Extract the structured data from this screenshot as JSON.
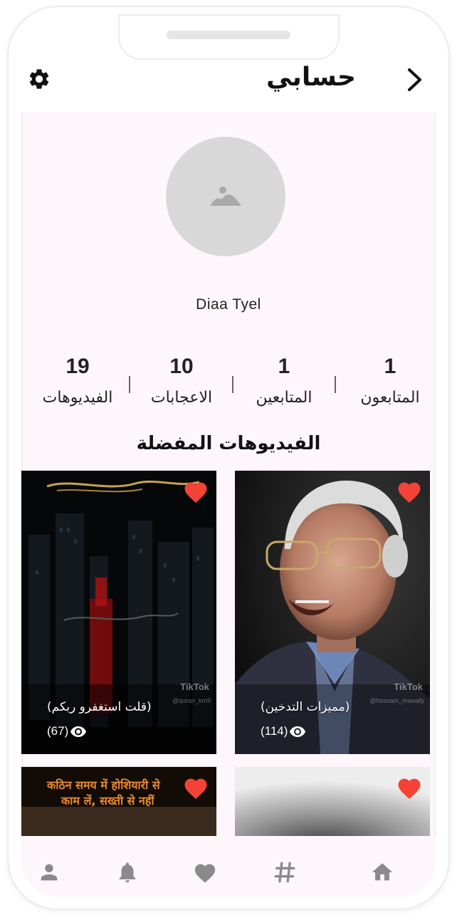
{
  "header": {
    "title": "حسابي",
    "settings_icon": "gear-icon",
    "back_icon": "chevron-right-icon"
  },
  "profile": {
    "avatar_icon": "image-placeholder-icon",
    "username": "Diaa Tyel"
  },
  "stats": [
    {
      "value": "1",
      "label": "المتابعون"
    },
    {
      "value": "1",
      "label": "المتابعين"
    },
    {
      "value": "10",
      "label": "الاعجابات"
    },
    {
      "value": "19",
      "label": "الفيديوهات"
    }
  ],
  "favorites": {
    "title": "الفيديوهات المفضلة",
    "videos": [
      {
        "caption": "(مميزات التدخين)",
        "views": "(114)",
        "watermark": "TikTok",
        "watermark_user": "@hossam_mawafy",
        "heart_color": "#f44336"
      },
      {
        "caption": "(قلت استغفرو ربكم)",
        "views": "(67)",
        "watermark": "TikTok",
        "watermark_user": "@quran_km9",
        "heart_color": "#f44336"
      },
      {
        "caption": "",
        "views": "",
        "heart_color": "#f44336"
      },
      {
        "caption": "",
        "views": "",
        "overlay_text_line1": "कठिन समय में होशियारी से",
        "overlay_text_line2": "काम लें, सख्ती से नहीं",
        "heart_color": "#f44336"
      }
    ]
  },
  "bottom_nav": [
    {
      "icon": "home-icon"
    },
    {
      "icon": "hashtag-icon"
    },
    {
      "icon": "heart-icon"
    },
    {
      "icon": "bell-icon"
    },
    {
      "icon": "person-icon"
    }
  ],
  "colors": {
    "accent_heart": "#f44336",
    "background": "#fdf7fb",
    "nav_icon": "#8a8a8a"
  }
}
